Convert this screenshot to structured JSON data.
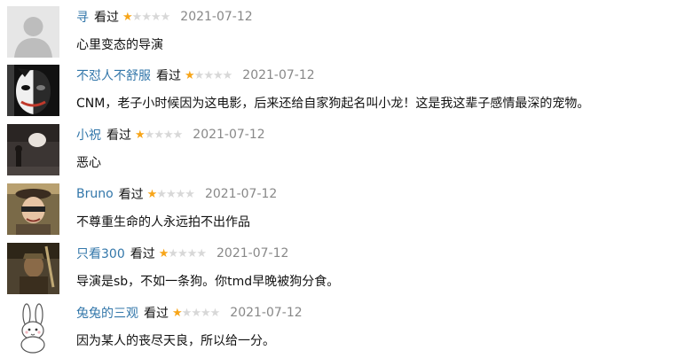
{
  "reviews": [
    {
      "user": "寻",
      "status": "看过",
      "rating": 1,
      "max_rating": 5,
      "date": "2021-07-12",
      "comment": "心里变态的导演",
      "avatar": "default-avatar"
    },
    {
      "user": "不怼人不舒服",
      "status": "看过",
      "rating": 1,
      "max_rating": 5,
      "date": "2021-07-12",
      "comment": "CNM，老子小时候因为这电影，后来还给自家狗起名叫小龙！这是我这辈子感情最深的宠物。",
      "avatar": "joker-mask-avatar"
    },
    {
      "user": "小祝",
      "status": "看过",
      "rating": 1,
      "max_rating": 5,
      "date": "2021-07-12",
      "comment": "恶心",
      "avatar": "dark-scene-avatar"
    },
    {
      "user": "Bruno",
      "status": "看过",
      "rating": 1,
      "max_rating": 5,
      "date": "2021-07-12",
      "comment": "不尊重生命的人永远拍不出作品",
      "avatar": "woman-hat-avatar"
    },
    {
      "user": "只看300",
      "status": "看过",
      "rating": 1,
      "max_rating": 5,
      "date": "2021-07-12",
      "comment": "导演是sb，不如一条狗。你tmd早晚被狗分食。",
      "avatar": "warrior-avatar"
    },
    {
      "user": "兔兔的三观",
      "status": "看过",
      "rating": 1,
      "max_rating": 5,
      "date": "2021-07-12",
      "comment": "因为某人的丧尽天良，所以给一分。",
      "avatar": "rabbit-avatar"
    }
  ],
  "colors": {
    "username": "#3377aa",
    "star_on": "#f7a519",
    "star_off": "#d8d8d8",
    "date": "#888888"
  }
}
